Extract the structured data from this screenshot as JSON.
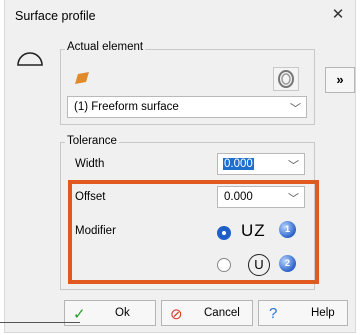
{
  "window": {
    "title": "Surface profile",
    "close_glyph": "✕"
  },
  "actual_element": {
    "legend": "Actual element",
    "dropdown_value": "(1) Freeform surface",
    "more_button": "»"
  },
  "tolerance": {
    "legend": "Tolerance",
    "width_label": "Width",
    "width_value": "0.000",
    "offset_label": "Offset",
    "offset_value": "0.000",
    "modifier_label": "Modifier",
    "modifier_options": [
      {
        "text": "UZ",
        "selected": true,
        "badge": "1"
      },
      {
        "text": "U",
        "selected": false,
        "badge": "2"
      }
    ]
  },
  "buttons": {
    "ok": "Ok",
    "cancel": "Cancel",
    "help": "Help"
  },
  "colors": {
    "accent": "#1e5fc8",
    "highlight": "#e0591f",
    "surface_icon": "#e08a2a",
    "ok_check": "#2a9d2a",
    "cancel_icon": "#d63a2a",
    "help_icon": "#2b6fd6"
  }
}
